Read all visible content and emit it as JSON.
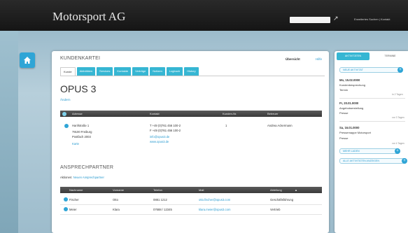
{
  "header": {
    "brand": "Motorsport AG",
    "links": "Erweitertes Suchen | Kontakt"
  },
  "panel": {
    "title": "KUNDENKARTEI",
    "overview": "Übersicht",
    "help": "Hilfe",
    "tabs": [
      "Kunde",
      "Aktivitäten",
      "Services",
      "Kontakte",
      "Verträge",
      "Notizen",
      "Logbuch",
      "History"
    ],
    "customer_name": "OPUS 3",
    "edit_link": "Ändern"
  },
  "address_table": {
    "headers": [
      "Adresse",
      "Kontakt",
      "Kunden-Nr.",
      "Betreuer"
    ],
    "row": {
      "street": "Hanfstraße 1",
      "city": "79100 Freiburg",
      "pobox": "Postfach 2003",
      "map_link": "Karte",
      "phone": "T +49 (0)761 456 100-2",
      "fax": "F +49 (0)761 456 100-2",
      "email": "info@opus3.de",
      "web": "www.opus3.de",
      "customer_no": "1",
      "manager": "Andrea Ackermann"
    }
  },
  "contacts": {
    "title": "ANSPRECHPARTNER",
    "subtitle_prefix": "Aktionen:",
    "subtitle_link": "Neuen Ansprechpartner",
    "headers": [
      "Nachname",
      "Vorname",
      "Telefon",
      "Mail",
      "Abteilung"
    ],
    "sort_indicator": "▲",
    "rows": [
      {
        "last": "Fischer",
        "first": "Otto",
        "phone": "0881 1212",
        "mail": "otto.fischer@opus3.com",
        "dept": "Geschäftsführung"
      },
      {
        "last": "Meier",
        "first": "Klara",
        "phone": "07688 / 12345",
        "mail": "klara.meier@opus3.com",
        "dept": "Vertrieb"
      }
    ]
  },
  "right_panel": {
    "tab_active": "AKTIVITÄTEN",
    "tab_other": "TERMINE",
    "new_activity": "NEUE AKTIVITÄT",
    "entries": [
      {
        "date": "Mo, 15.02.0000",
        "link": "Kundenbesprechung",
        "type": "Termin",
        "meta": "in 2 Tagen"
      },
      {
        "date": "Fr, 20.01.0000",
        "link": "Angebotserstellung",
        "type": "Presse",
        "meta": "vor 3 Tagen"
      },
      {
        "date": "Sa, 16.01.0000",
        "link": "Pressemappe Motorsport",
        "type": "Presse",
        "meta": "vor 4 Tagen"
      }
    ],
    "btn_more": "MEHR LADEN",
    "btn_all": "ALLE AKTIVITÄTEN ANZEIGEN"
  }
}
